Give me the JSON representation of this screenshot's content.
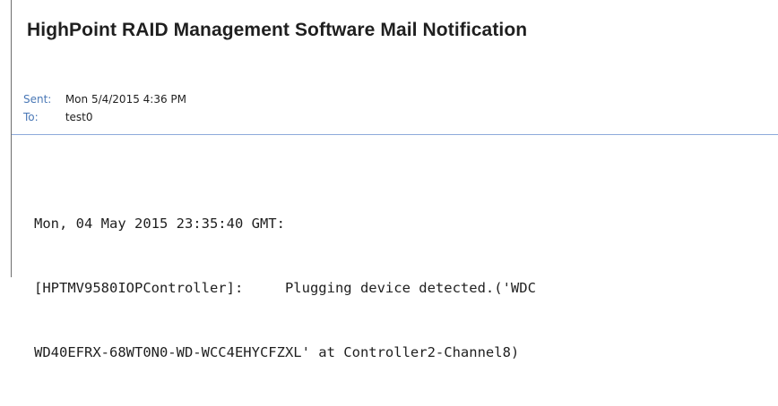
{
  "email": {
    "subject": "HighPoint RAID Management Software Mail Notification",
    "sent_label": "Sent:",
    "sent_value": "Mon 5/4/2015 4:36 PM",
    "to_label": "To:",
    "to_value": "test0",
    "body_lines": [
      "Mon, 04 May 2015 23:35:40 GMT:",
      "[HPTMV9580IOPController]:     Plugging device detected.('WDC",
      "WD40EFRX-68WT0N0-WD-WCC4EHYCFZXL' at Controller2-Channel8)"
    ]
  },
  "colors": {
    "label_blue": "#4a78b6",
    "divider_blue": "#8eaadb",
    "text": "#1f1f1f"
  }
}
